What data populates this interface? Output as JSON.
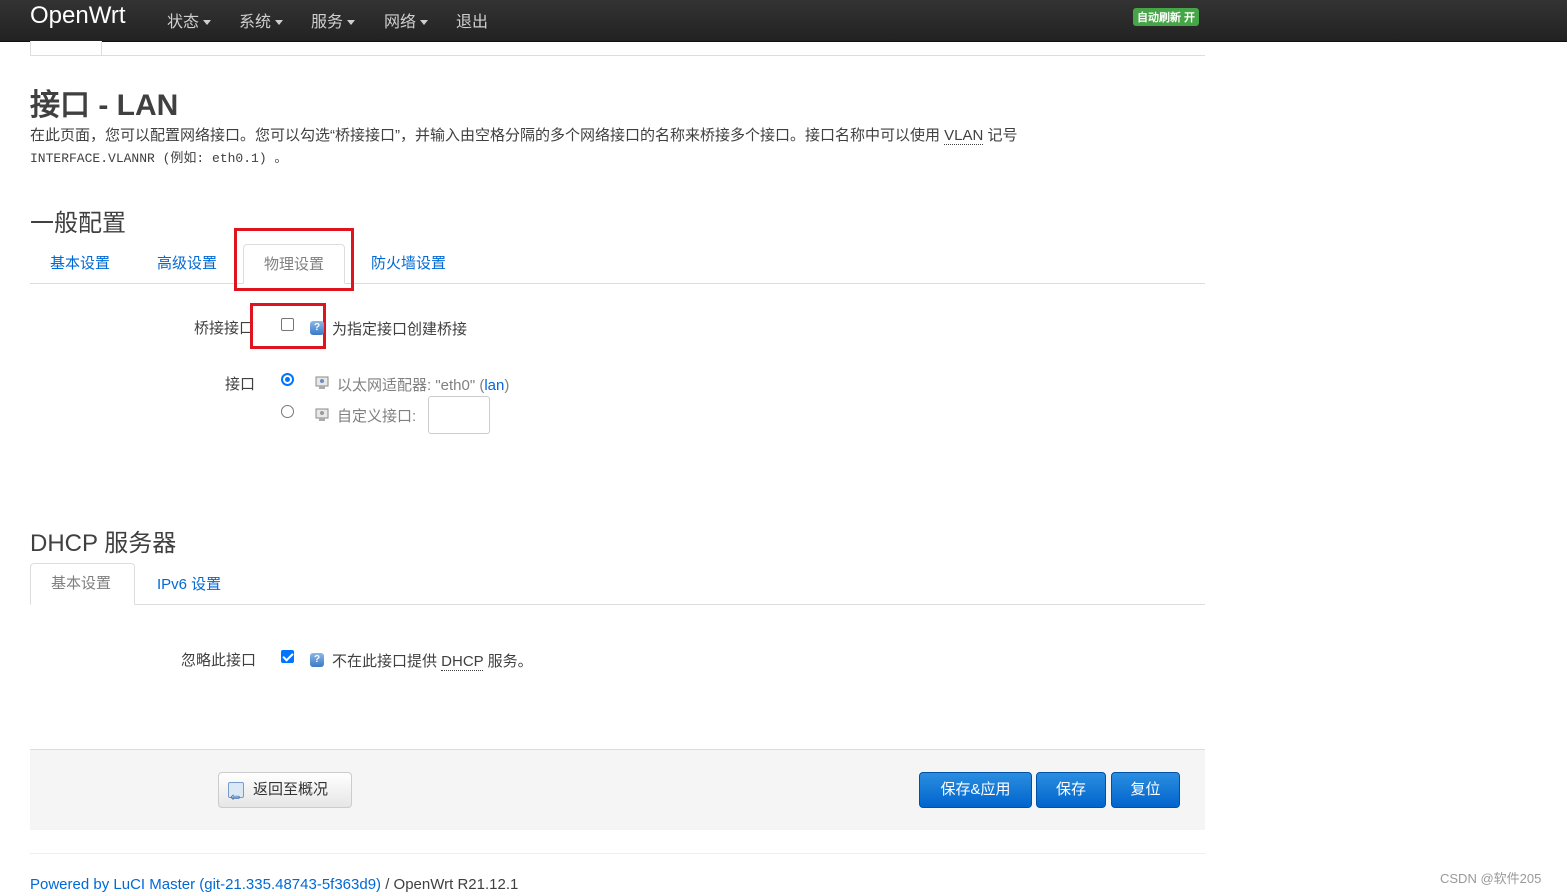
{
  "navbar": {
    "brand": "OpenWrt",
    "menu": [
      {
        "label": "状态",
        "dropdown": true
      },
      {
        "label": "系统",
        "dropdown": true
      },
      {
        "label": "服务",
        "dropdown": true
      },
      {
        "label": "网络",
        "dropdown": true
      },
      {
        "label": "退出",
        "dropdown": false
      }
    ],
    "auto_refresh": "自动刷新 开"
  },
  "page": {
    "title": "接口 - LAN",
    "description_1": "在此页面，您可以配置网络接口。您可以勾选“桥接接口”，并输入由空格分隔的多个网络接口的名称来桥接多个接口。接口名称中可以使用 ",
    "description_abbr": "VLAN",
    "description_2": " 记号",
    "description_mono": "INTERFACE.VLANNR (例如: eth0.1) 。"
  },
  "general": {
    "heading": "一般配置",
    "tabs": [
      "基本设置",
      "高级设置",
      "物理设置",
      "防火墙设置"
    ],
    "active_tab": "物理设置",
    "bridge": {
      "label": "桥接接口",
      "checked": false,
      "help": "为指定接口创建桥接"
    },
    "interface": {
      "label": "接口",
      "option1_text": "以太网适配器: \"eth0\" (",
      "option1_link": "lan",
      "option1_end": ")",
      "option2_text": "自定义接口:",
      "selected": 1
    }
  },
  "dhcp": {
    "heading": "DHCP 服务器",
    "tabs": [
      "基本设置",
      "IPv6 设置"
    ],
    "active_tab": "基本设置",
    "ignore": {
      "label": "忽略此接口",
      "checked": true,
      "help_1": "不在此接口提供 ",
      "help_abbr": "DHCP",
      "help_2": " 服务。"
    }
  },
  "actions": {
    "back": "返回至概况",
    "save_apply": "保存&应用",
    "save": "保存",
    "reset": "复位"
  },
  "footer": {
    "link": "Powered by LuCI Master (git-21.335.48743-5f363d9)",
    "text": " / OpenWrt R21.12.1"
  },
  "watermark": "CSDN @软件205",
  "colors": {
    "accent": "#0069d6",
    "highlight": "#e0141e",
    "badge": "#46a546"
  }
}
